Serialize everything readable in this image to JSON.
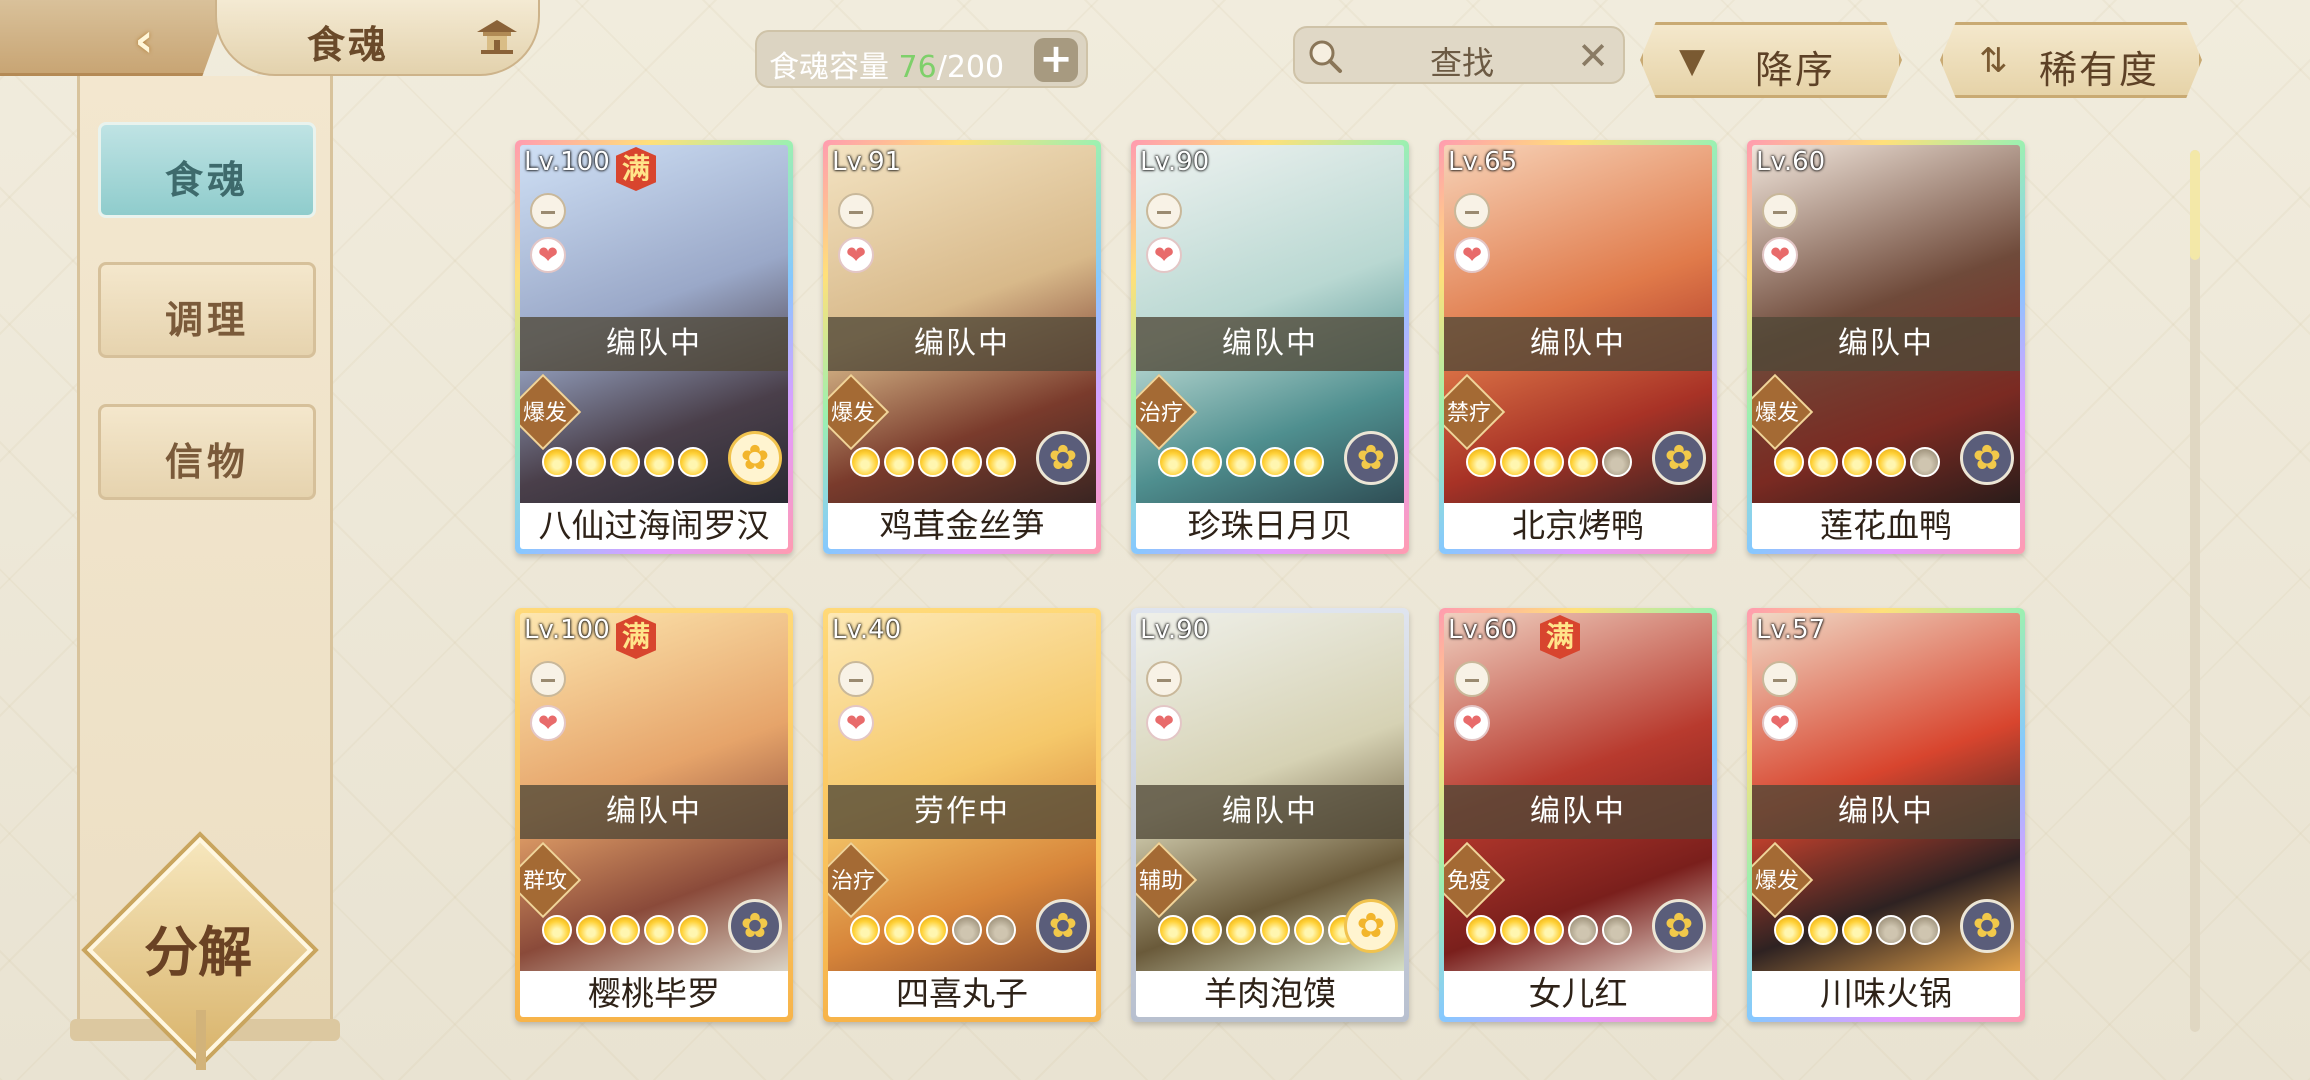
{
  "header": {
    "title": "食魂",
    "capacity_label": "食魂容量",
    "capacity_current": "76",
    "capacity_total": "/200",
    "search_placeholder": "查找",
    "sort_order_label": "降序",
    "sort_field_label": "稀有度"
  },
  "sidebar": {
    "items": [
      {
        "label": "食魂",
        "active": true
      },
      {
        "label": "调理",
        "active": false
      },
      {
        "label": "信物",
        "active": false
      }
    ],
    "decompose_label": "分解"
  },
  "cards": [
    {
      "level": "Lv.100",
      "maxed": "满",
      "state": "编队中",
      "role": "爆发",
      "stars_on": 5,
      "stars_total": 5,
      "name": "八仙过海闹罗汉"
    },
    {
      "level": "Lv.91",
      "maxed": "",
      "state": "编队中",
      "role": "爆发",
      "stars_on": 5,
      "stars_total": 5,
      "name": "鸡茸金丝笋"
    },
    {
      "level": "Lv.90",
      "maxed": "",
      "state": "编队中",
      "role": "治疗",
      "stars_on": 5,
      "stars_total": 5,
      "name": "珍珠日月贝"
    },
    {
      "level": "Lv.65",
      "maxed": "",
      "state": "编队中",
      "role": "禁疗",
      "stars_on": 4,
      "stars_total": 5,
      "name": "北京烤鸭"
    },
    {
      "level": "Lv.60",
      "maxed": "",
      "state": "编队中",
      "role": "爆发",
      "stars_on": 4,
      "stars_total": 5,
      "name": "莲花血鸭"
    },
    {
      "level": "Lv.100",
      "maxed": "满",
      "state": "编队中",
      "role": "群攻",
      "stars_on": 5,
      "stars_total": 5,
      "name": "樱桃毕罗"
    },
    {
      "level": "Lv.40",
      "maxed": "",
      "state": "劳作中",
      "role": "治疗",
      "stars_on": 3,
      "stars_total": 5,
      "name": "四喜丸子"
    },
    {
      "level": "Lv.90",
      "maxed": "",
      "state": "编队中",
      "role": "辅助",
      "stars_on": 6,
      "stars_total": 6,
      "name": "羊肉泡馍"
    },
    {
      "level": "Lv.60",
      "maxed": "满",
      "state": "编队中",
      "role": "免疫",
      "stars_on": 3,
      "stars_total": 5,
      "name": "女儿红"
    },
    {
      "level": "Lv.57",
      "maxed": "",
      "state": "编队中",
      "role": "爆发",
      "stars_on": 3,
      "stars_total": 5,
      "name": "川味火锅"
    }
  ]
}
